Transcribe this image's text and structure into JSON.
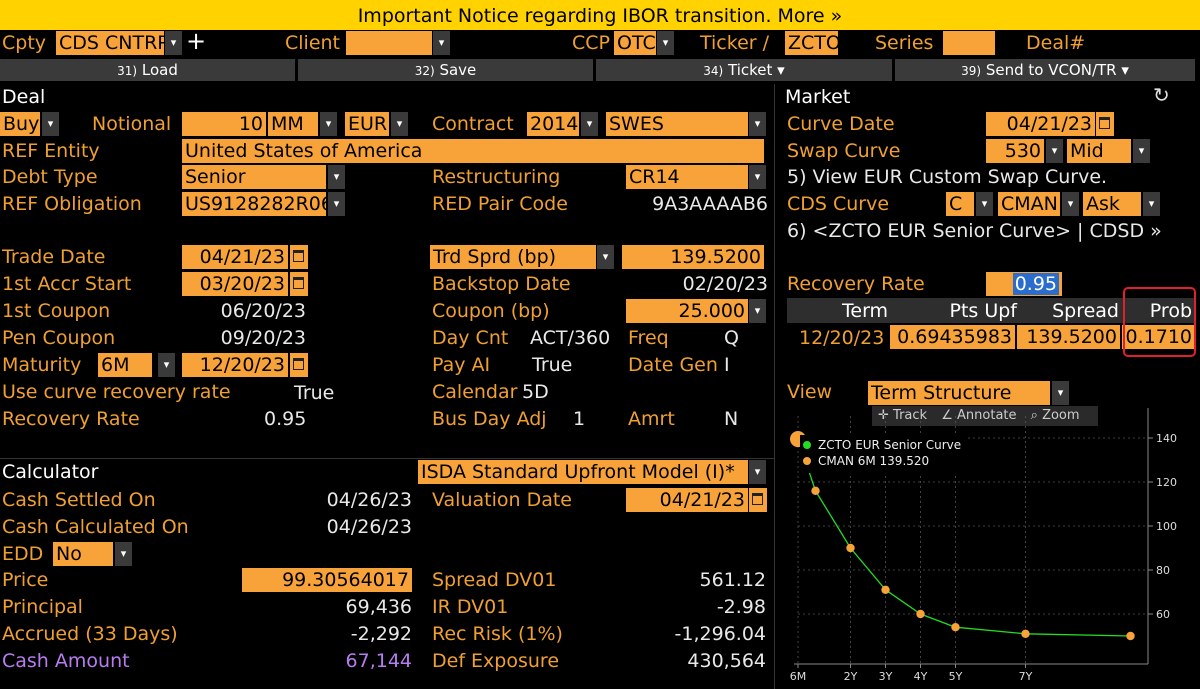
{
  "notice": "Important Notice regarding IBOR transition. More »",
  "topbar": {
    "cpty_label": "Cpty",
    "cpty_value": "CDS CNTRP",
    "client_label": "Client",
    "client_value": "",
    "ccp_label": "CCP",
    "ccp_value": "OTC",
    "ticker_label": "Ticker /",
    "ticker_value": "ZCTO",
    "series_label": "Series",
    "series_value": "",
    "deal_label": "Deal#"
  },
  "toolbar": {
    "load_num": "31)",
    "load_label": "Load",
    "save_num": "32)",
    "save_label": "Save",
    "ticket_num": "34)",
    "ticket_label": "Ticket ▾",
    "send_num": "39)",
    "send_label": "Send to VCON/TR ▾"
  },
  "deal": {
    "title": "Deal",
    "side": "Buy",
    "notional_label": "Notional",
    "notional_value": "10",
    "notional_unit": "MM",
    "currency": "EUR",
    "contract_label": "Contract",
    "contract_year": "2014",
    "contract_type": "SWES",
    "ref_entity_label": "REF Entity",
    "ref_entity_value": "United States of America",
    "debt_type_label": "Debt Type",
    "debt_type_value": "Senior",
    "restructuring_label": "Restructuring",
    "restructuring_value": "CR14",
    "ref_obligation_label": "REF Obligation",
    "ref_obligation_value": "US9128282R06",
    "red_label": "RED Pair Code",
    "red_value": "9A3AAAAB6",
    "trade_date_label": "Trade Date",
    "trade_date_value": "04/21/23",
    "trd_sprd_label": "Trd Sprd (bp)",
    "trd_sprd_value": "139.5200",
    "accr_label": "1st Accr Start",
    "accr_value": "03/20/23",
    "backstop_label": "Backstop Date",
    "backstop_value": "02/20/23",
    "first_coupon_label": "1st Coupon",
    "first_coupon_value": "06/20/23",
    "coupon_label": "Coupon (bp)",
    "coupon_value": "25.000",
    "pen_coupon_label": "Pen Coupon",
    "pen_coupon_value": "09/20/23",
    "day_cnt_label": "Day Cnt",
    "day_cnt_value": "ACT/360",
    "freq_label": "Freq",
    "freq_value": "Q",
    "maturity_label": "Maturity",
    "maturity_tenor": "6M",
    "maturity_value": "12/20/23",
    "pay_ai_label": "Pay AI",
    "pay_ai_value": "True",
    "date_gen_label": "Date Gen",
    "date_gen_value": "I",
    "use_curve_label": "Use curve recovery rate",
    "use_curve_value": "True",
    "calendar_label": "Calendar",
    "calendar_value": "5D",
    "recovery_label": "Recovery Rate",
    "recovery_value": "0.95",
    "bus_day_label": "Bus Day Adj",
    "bus_day_value": "1",
    "amrt_label": "Amrt",
    "amrt_value": "N"
  },
  "calculator": {
    "title": "Calculator",
    "model": "ISDA Standard Upfront Model (I)*",
    "cash_settled_label": "Cash Settled On",
    "cash_settled_value": "04/26/23",
    "valuation_label": "Valuation Date",
    "valuation_value": "04/21/23",
    "cash_calc_label": "Cash Calculated On",
    "cash_calc_value": "04/26/23",
    "edd_label": "EDD",
    "edd_value": "No",
    "price_label": "Price",
    "price_value": "99.30564017",
    "spread_dv01_label": "Spread DV01",
    "spread_dv01_value": "561.12",
    "principal_label": "Principal",
    "principal_value": "69,436",
    "ir_dv01_label": "IR DV01",
    "ir_dv01_value": "-2.98",
    "accrued_label": "Accrued (33 Days)",
    "accrued_value": "-2,292",
    "rec_risk_label": "Rec Risk (1%)",
    "rec_risk_value": "-1,296.04",
    "cash_amount_label": "Cash Amount",
    "cash_amount_value": "67,144",
    "def_exposure_label": "Def Exposure",
    "def_exposure_value": "430,564"
  },
  "market": {
    "title": "Market",
    "refresh_icon": "refresh-icon",
    "curve_date_label": "Curve Date",
    "curve_date_value": "04/21/23",
    "swap_curve_label": "Swap Curve",
    "swap_curve_value": "530",
    "swap_curve_side": "Mid",
    "view_swap_link": "5) View EUR Custom Swap Curve.",
    "cds_curve_label": "CDS Curve",
    "cds_curve_type": "C",
    "cds_curve_source": "CMAN",
    "cds_curve_side": "Ask",
    "cds_curve_link": "6) <ZCTO EUR Senior Curve> | CDSD »",
    "recovery_label": "Recovery Rate",
    "recovery_value": "0.95",
    "table_headers": [
      "Term",
      "Pts Upf",
      "Spread",
      "Prob"
    ],
    "table_row": {
      "term": "12/20/23",
      "pts_upf": "0.69435983",
      "spread": "139.5200",
      "prob": "0.1710"
    },
    "view_label": "View",
    "view_value": "Term Structure",
    "chart_tools": {
      "track": "Track",
      "annotate": "Annotate",
      "zoom": "Zoom"
    }
  },
  "chart_data": {
    "type": "line",
    "legend": [
      {
        "name": "ZCTO EUR Senior Curve",
        "color": "#22dd22"
      },
      {
        "name": "CMAN 6M 139.520",
        "color": "#f7a33a"
      }
    ],
    "x_ticks": [
      "6M",
      "2Y",
      "3Y",
      "4Y",
      "5Y",
      "7Y"
    ],
    "x": [
      0.5,
      1,
      2,
      3,
      4,
      5,
      7,
      10
    ],
    "y": [
      139.52,
      116,
      90,
      71,
      60,
      54,
      51,
      50
    ],
    "yticks": [
      60,
      80,
      100,
      120,
      140
    ],
    "ylim": [
      40,
      150
    ],
    "xlim": [
      0.5,
      10.5
    ],
    "highlight_point": {
      "x": 0.5,
      "y": 139.52
    },
    "grid": true
  }
}
